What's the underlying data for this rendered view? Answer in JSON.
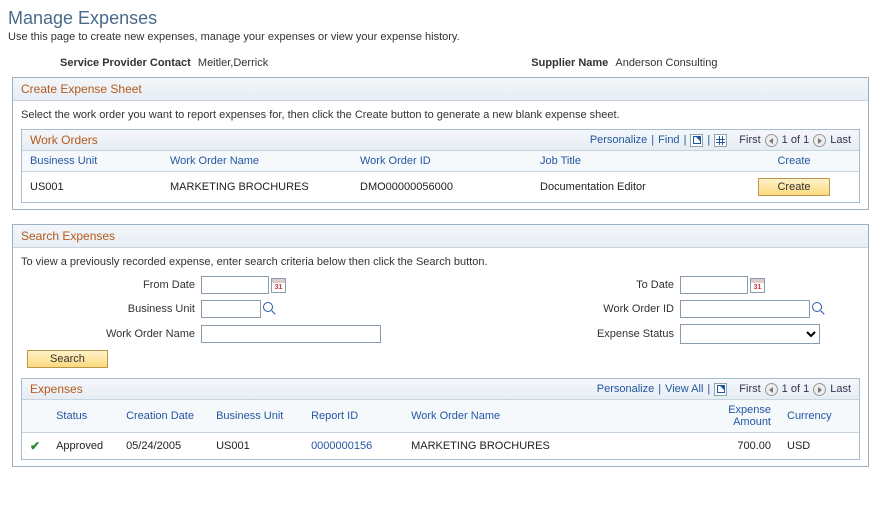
{
  "page": {
    "title": "Manage Expenses",
    "description": "Use this page to create new expenses, manage your expenses or view your expense history."
  },
  "contact": {
    "provider_label": "Service Provider Contact",
    "provider_value": "Meitler,Derrick",
    "supplier_label": "Supplier Name",
    "supplier_value": "Anderson Consulting"
  },
  "create_panel": {
    "title": "Create Expense Sheet",
    "instruction": "Select the work order you want to report expenses for, then click the Create button to generate a new blank expense sheet.",
    "subtitle": "Work Orders",
    "toolbar": {
      "personalize": "Personalize",
      "find": "Find",
      "nav_text": "1 of 1",
      "first": "First",
      "last": "Last"
    },
    "columns": {
      "bu": "Business Unit",
      "woname": "Work Order Name",
      "woid": "Work Order ID",
      "job": "Job Title",
      "create": "Create"
    },
    "row": {
      "bu": "US001",
      "woname": "MARKETING BROCHURES",
      "woid": "DMO00000056000",
      "job": "Documentation Editor",
      "create_btn": "Create"
    }
  },
  "search_panel": {
    "title": "Search Expenses",
    "instruction": "To view a previously recorded expense, enter search criteria below then click the Search button.",
    "labels": {
      "from_date": "From Date",
      "to_date": "To Date",
      "bu": "Business Unit",
      "woid": "Work Order ID",
      "woname": "Work Order Name",
      "status": "Expense Status"
    },
    "values": {
      "from_date": "",
      "to_date": "",
      "bu": "",
      "woid": "",
      "woname": "",
      "status": ""
    },
    "search_btn": "Search"
  },
  "expenses_panel": {
    "title": "Expenses",
    "toolbar": {
      "personalize": "Personalize",
      "viewall": "View All",
      "nav_text": "1 of 1",
      "first": "First",
      "last": "Last"
    },
    "columns": {
      "status": "Status",
      "cdate": "Creation Date",
      "bu": "Business Unit",
      "rid": "Report ID",
      "woname": "Work Order Name",
      "amount": "Expense Amount",
      "currency": "Currency"
    },
    "row": {
      "status": "Approved",
      "cdate": "05/24/2005",
      "bu": "US001",
      "rid": "0000000156",
      "woname": "MARKETING BROCHURES",
      "amount": "700.00",
      "currency": "USD"
    }
  }
}
